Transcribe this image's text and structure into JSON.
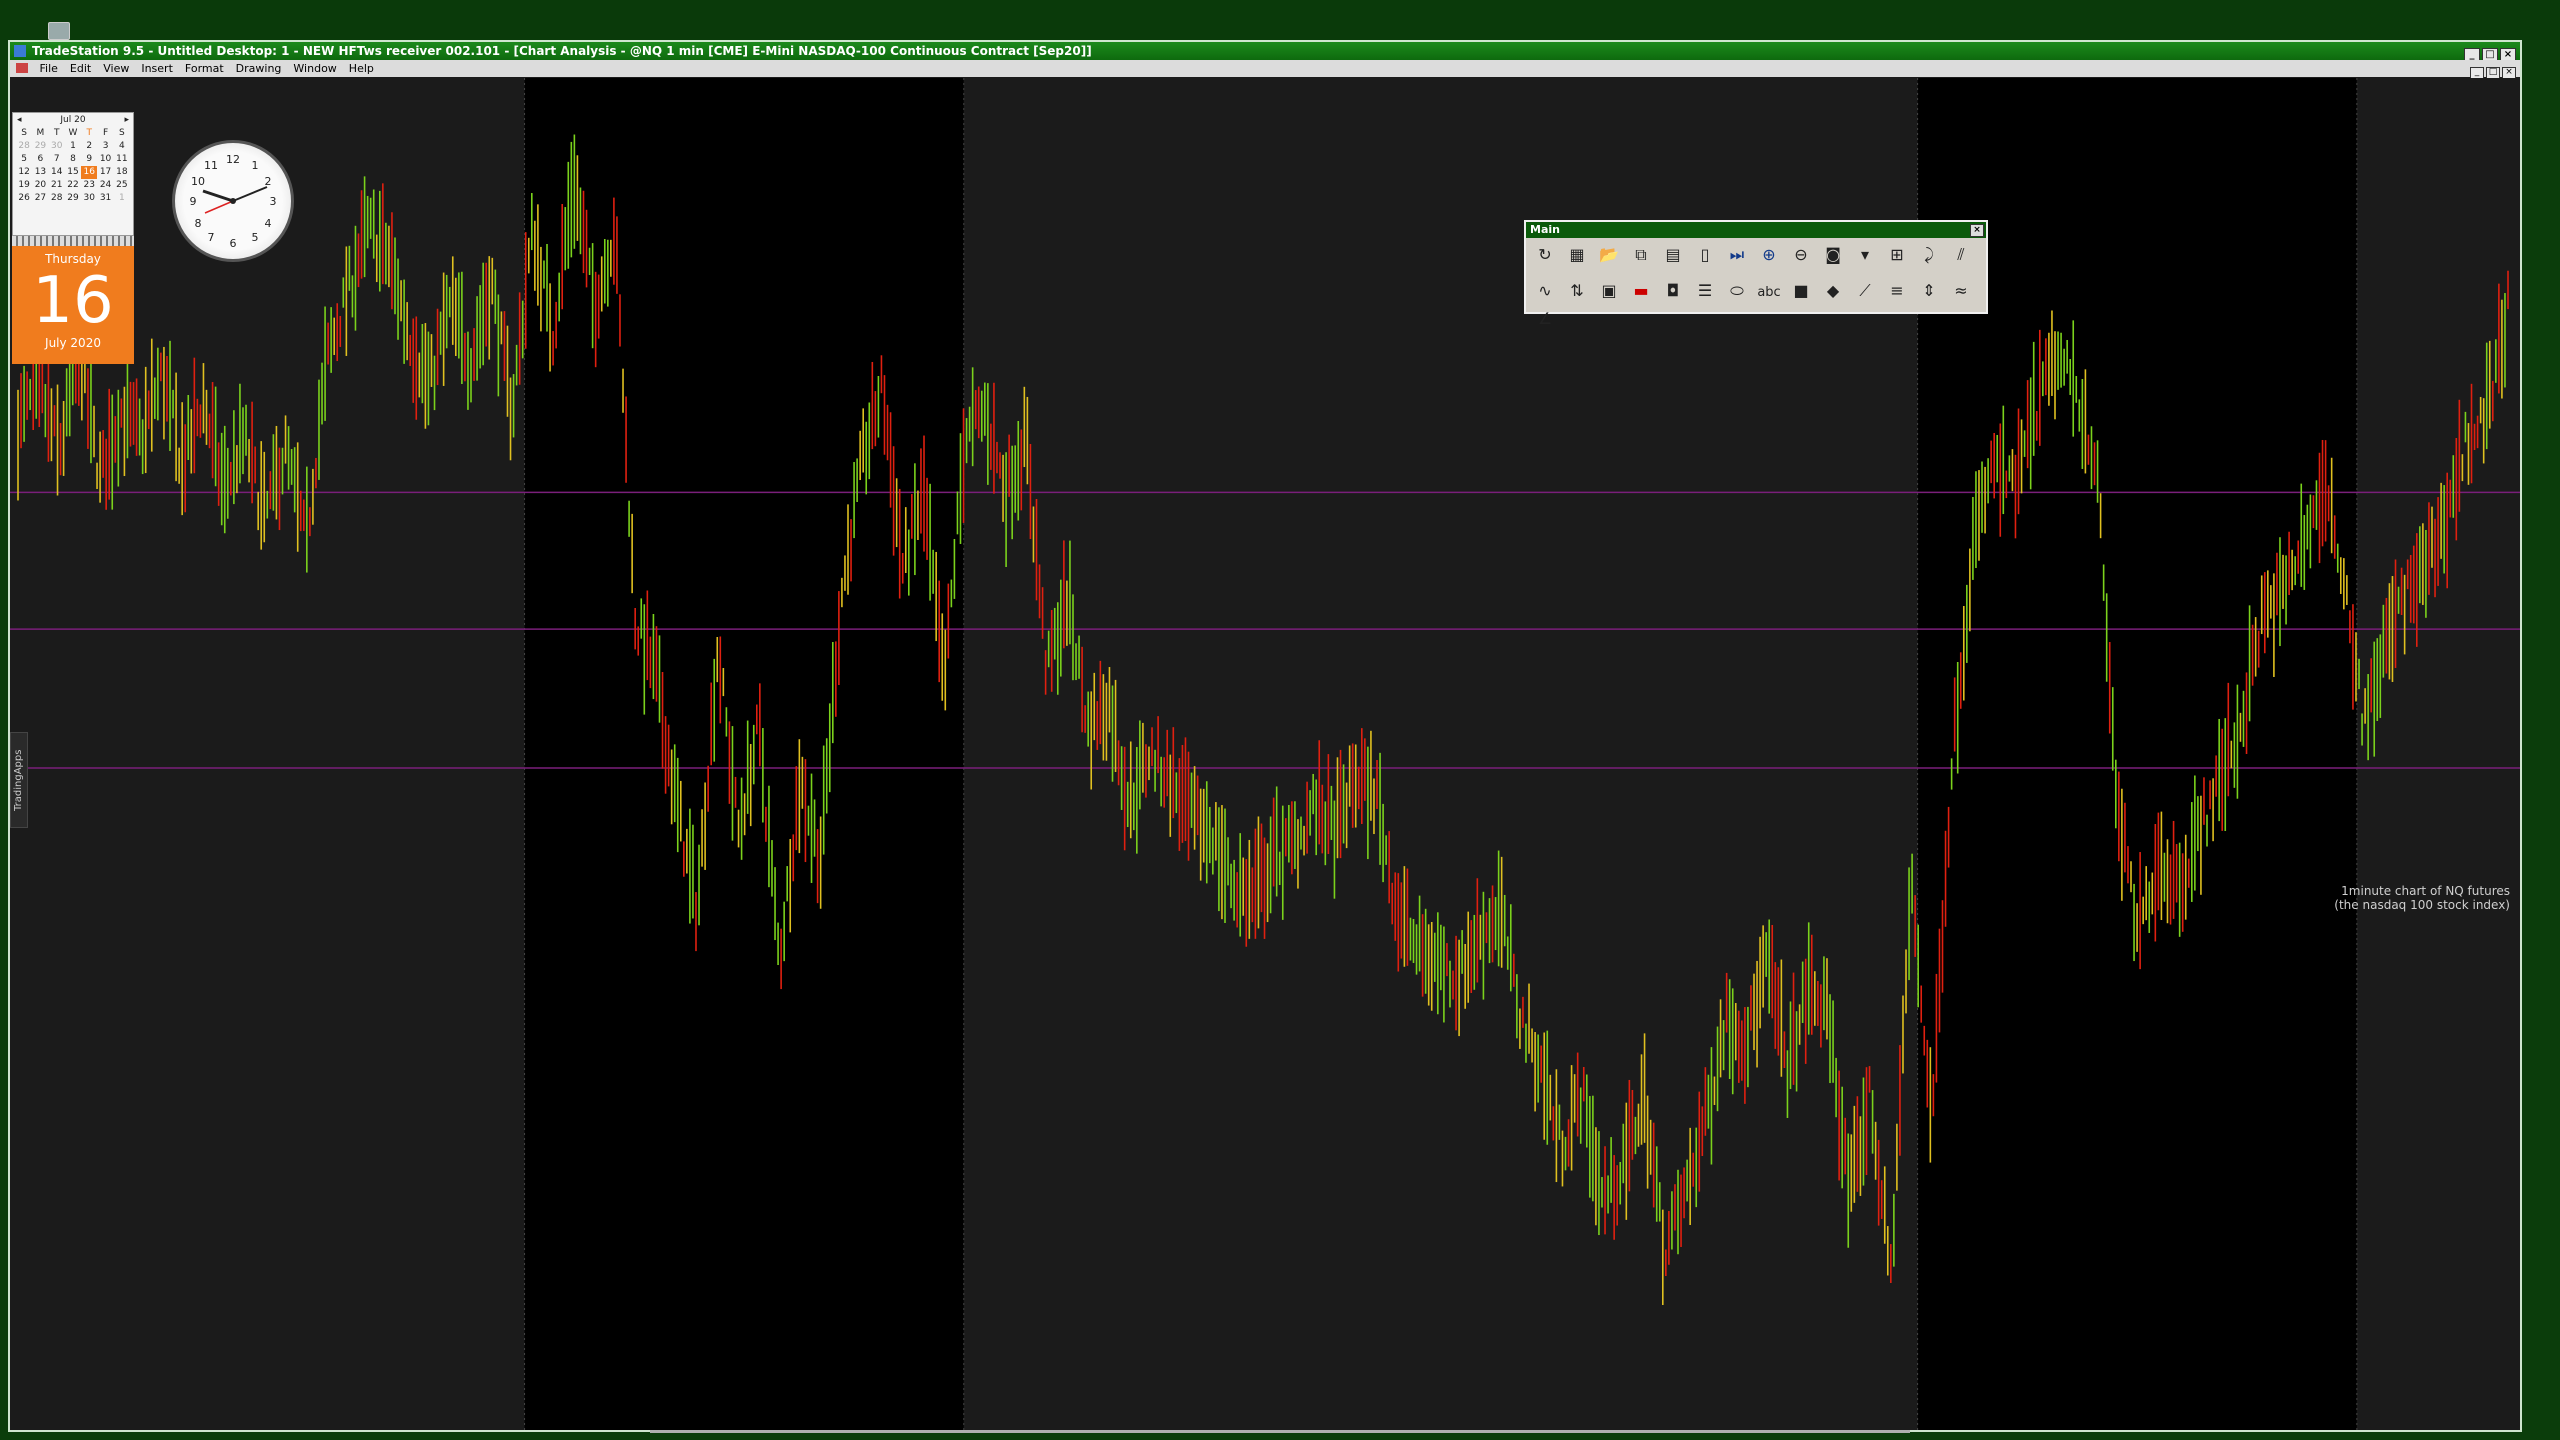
{
  "window": {
    "title": "TradeStation 9.5 - Untitled Desktop: 1 - NEW HFTws receiver 002.101 - [Chart Analysis - @NQ 1 min [CME] E-Mini NASDAQ-100 Continuous Contract [Sep20]]"
  },
  "menu": [
    "File",
    "Edit",
    "View",
    "Insert",
    "Format",
    "Drawing",
    "Window",
    "Help"
  ],
  "calendar": {
    "month_label": "Jul 20",
    "weekdays": [
      "S",
      "M",
      "T",
      "W",
      "T",
      "F",
      "S"
    ],
    "days": [
      "28",
      "29",
      "30",
      "1",
      "2",
      "3",
      "4",
      "5",
      "6",
      "7",
      "8",
      "9",
      "10",
      "11",
      "12",
      "13",
      "14",
      "15",
      "16",
      "17",
      "18",
      "19",
      "20",
      "21",
      "22",
      "23",
      "24",
      "25",
      "26",
      "27",
      "28",
      "29",
      "30",
      "31",
      "1"
    ],
    "dim_days": [
      0,
      1,
      2,
      34
    ],
    "today_index": 18,
    "weekday": "Thursday",
    "day_number": "16",
    "month_year": "July 2020"
  },
  "side_tab": "TradingApps",
  "toolbar": {
    "title": "Main",
    "row1_icons": [
      "refresh-icon",
      "window-icon",
      "open-folder-icon",
      "copy-icon",
      "notes-icon",
      "page-icon",
      "play-end-icon",
      "zoom-in-icon",
      "zoom-out-icon",
      "chart-icon",
      "dropdown-icon",
      "grid-icon",
      "curve-icon",
      "lines-icon"
    ],
    "row2_icons": [
      "indicator-icon",
      "strategy-icon",
      "layout-icon",
      "color-bar-icon",
      "camera-icon",
      "list-icon",
      "ellipse-icon",
      "text-icon",
      "eraser-icon",
      "trendline-icon",
      "fib-icon",
      "price-marker-icon",
      "wave-icon",
      "angle-icon"
    ],
    "text_tool_label": "abc"
  },
  "chart_annotation": {
    "line1": "1minute chart of NQ futures",
    "line2": "(the nasdaq 100 stock index)"
  },
  "colors": {
    "session_light": "#1b1b1b",
    "session_dark": "#000000",
    "up_bar": "#7bd21c",
    "down_bar": "#e02010",
    "neutral_bar": "#e0c020",
    "level_line": "#7a1f7a"
  },
  "chart_data": {
    "type": "line",
    "title": "",
    "xlabel": "",
    "ylabel": "",
    "ylim": [
      0,
      100
    ],
    "series": [
      {
        "values": [
          75,
          78,
          73,
          80,
          71,
          76,
          74,
          79,
          72,
          77,
          70,
          74,
          68,
          73,
          66,
          80,
          85,
          90,
          88,
          82,
          78,
          84,
          80,
          86,
          76,
          90,
          82,
          94,
          84,
          90,
          60,
          56,
          46,
          38,
          58,
          44,
          52,
          34,
          48,
          42,
          62,
          72,
          78,
          64,
          70,
          55,
          74,
          76,
          70,
          74,
          56,
          62,
          52,
          54,
          46,
          50,
          48,
          45,
          44,
          40,
          39,
          42,
          43,
          46,
          44,
          48,
          47,
          38,
          35,
          34,
          33,
          36,
          38,
          30,
          26,
          20,
          24,
          16,
          18,
          24,
          12,
          16,
          22,
          30,
          28,
          34,
          26,
          32,
          30,
          16,
          24,
          10,
          40,
          22,
          50,
          66,
          72,
          70,
          76,
          80,
          78,
          72,
          46,
          36,
          42,
          40,
          44,
          48,
          52,
          60,
          62,
          66,
          70,
          64,
          52,
          58,
          62,
          64,
          68,
          74,
          76,
          84
        ]
      }
    ],
    "session_shading": [
      "light",
      "dark",
      "light",
      "dark",
      "light"
    ],
    "horizontal_levels": 3,
    "grid": false
  }
}
